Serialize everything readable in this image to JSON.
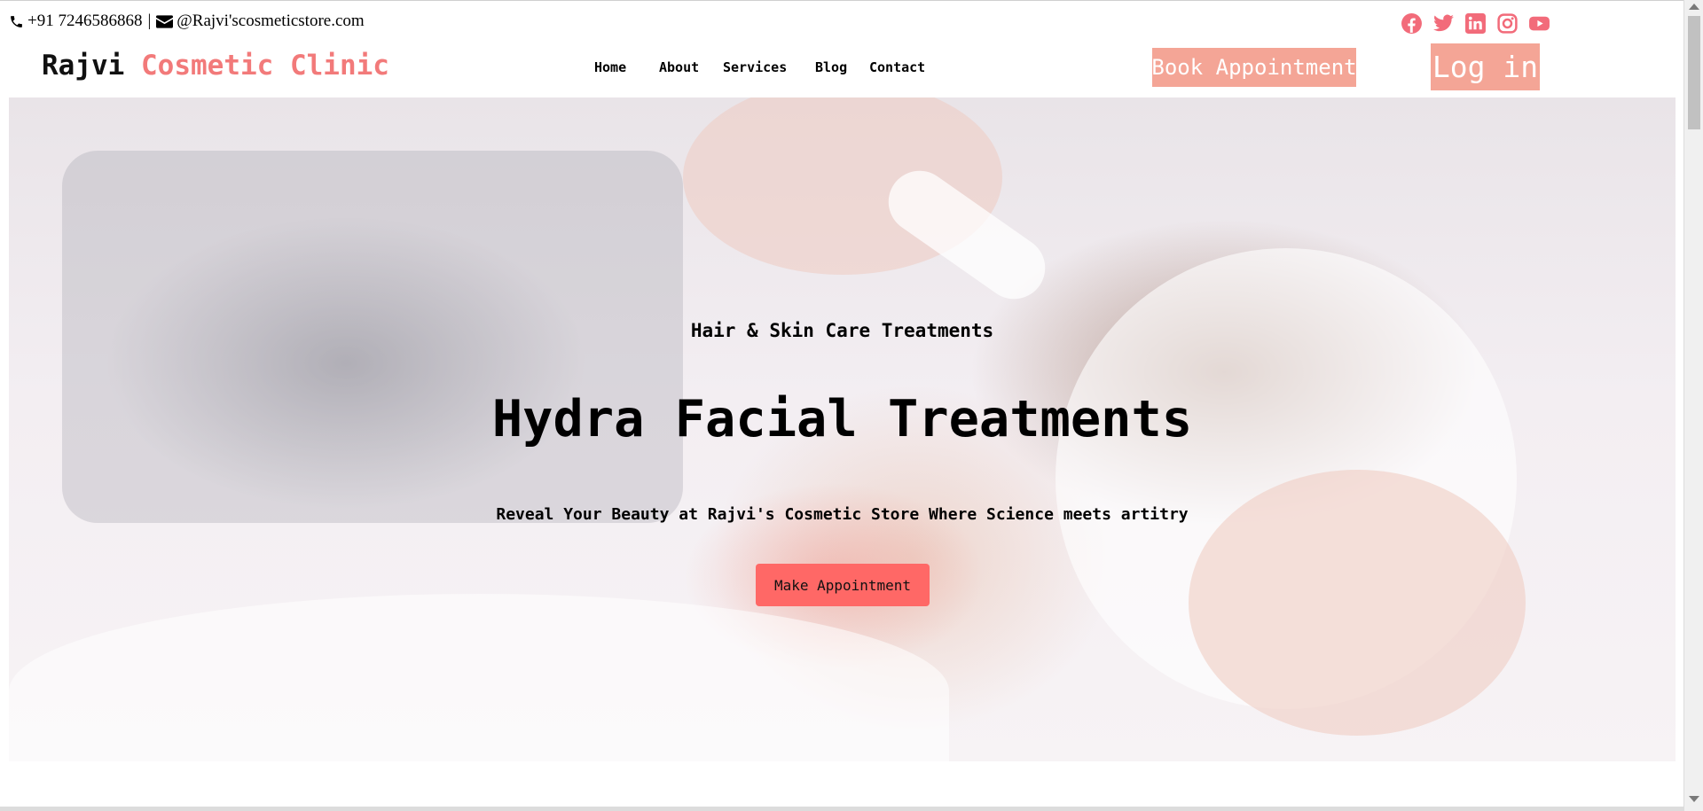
{
  "topbar": {
    "phone": "+91 7246586868",
    "separator": "|",
    "email": "@Rajvi'scosmeticstore.com",
    "icons": [
      "phone-icon",
      "envelope-icon"
    ],
    "social_icons": [
      "facebook-icon",
      "twitter-icon",
      "linkedin-icon",
      "instagram-icon",
      "youtube-icon"
    ],
    "social_color": "#f26b7a"
  },
  "brand": {
    "name": "Rajvi",
    "accent": "Cosmetic Clinic",
    "accent_color": "#f27a7a"
  },
  "nav": {
    "items": [
      "Home",
      "About",
      "Services",
      "Blog",
      "Contact"
    ]
  },
  "actions": {
    "book_label": "Book Appointment",
    "login_label": "Log in",
    "color": "#f4a596"
  },
  "hero": {
    "subtitle": "Hair & Skin Care Treatments",
    "title": "Hydra Facial Treatments",
    "tagline": "Reveal Your Beauty at Rajvi's Cosmetic Store Where Science meets artitry",
    "cta_label": "Make Appointment",
    "cta_color": "#ff6866"
  }
}
